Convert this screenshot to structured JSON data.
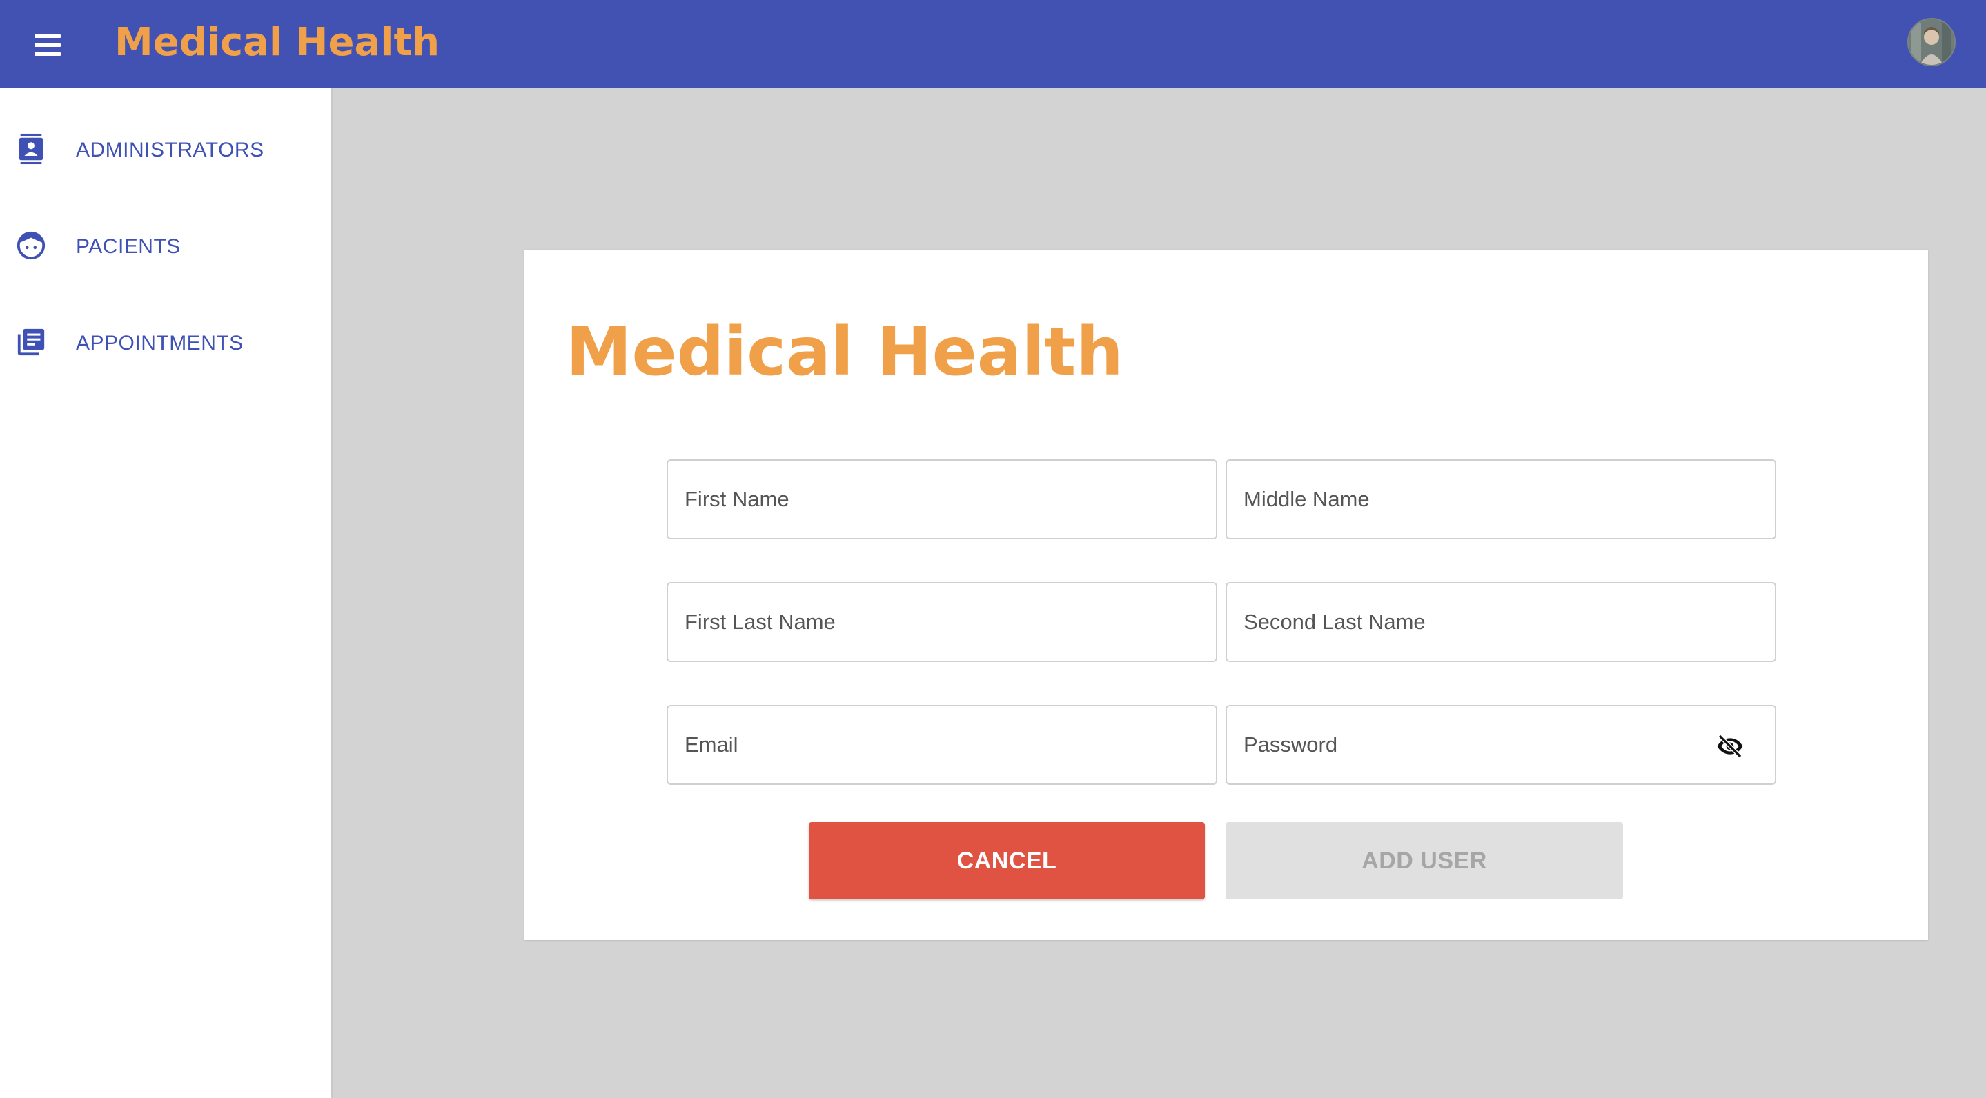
{
  "header": {
    "title": "Medical Health",
    "menu_icon": "hamburger-menu-icon",
    "avatar_icon": "user-avatar"
  },
  "sidebar": {
    "items": [
      {
        "label": "ADMINISTRATORS",
        "icon": "contact-card-icon"
      },
      {
        "label": "PACIENTS",
        "icon": "face-icon"
      },
      {
        "label": "APPOINTMENTS",
        "icon": "library-books-icon"
      }
    ]
  },
  "form": {
    "title": "Medical Health",
    "fields": {
      "first_name": {
        "placeholder": "First Name",
        "value": ""
      },
      "middle_name": {
        "placeholder": "Middle Name",
        "value": ""
      },
      "first_last_name": {
        "placeholder": "First Last Name",
        "value": ""
      },
      "second_last_name": {
        "placeholder": "Second Last Name",
        "value": ""
      },
      "email": {
        "placeholder": "Email",
        "value": ""
      },
      "password": {
        "placeholder": "Password",
        "value": "",
        "toggle_icon": "visibility-off-icon"
      }
    },
    "cancel_label": "CANCEL",
    "add_label": "ADD USER"
  },
  "colors": {
    "header_bg": "#4152b2",
    "brand_orange": "#f1a04a",
    "nav_blue": "#3f51b5",
    "cancel_red": "#e05241",
    "disabled_gray": "#e0e0e0",
    "page_bg": "#d3d3d3"
  }
}
